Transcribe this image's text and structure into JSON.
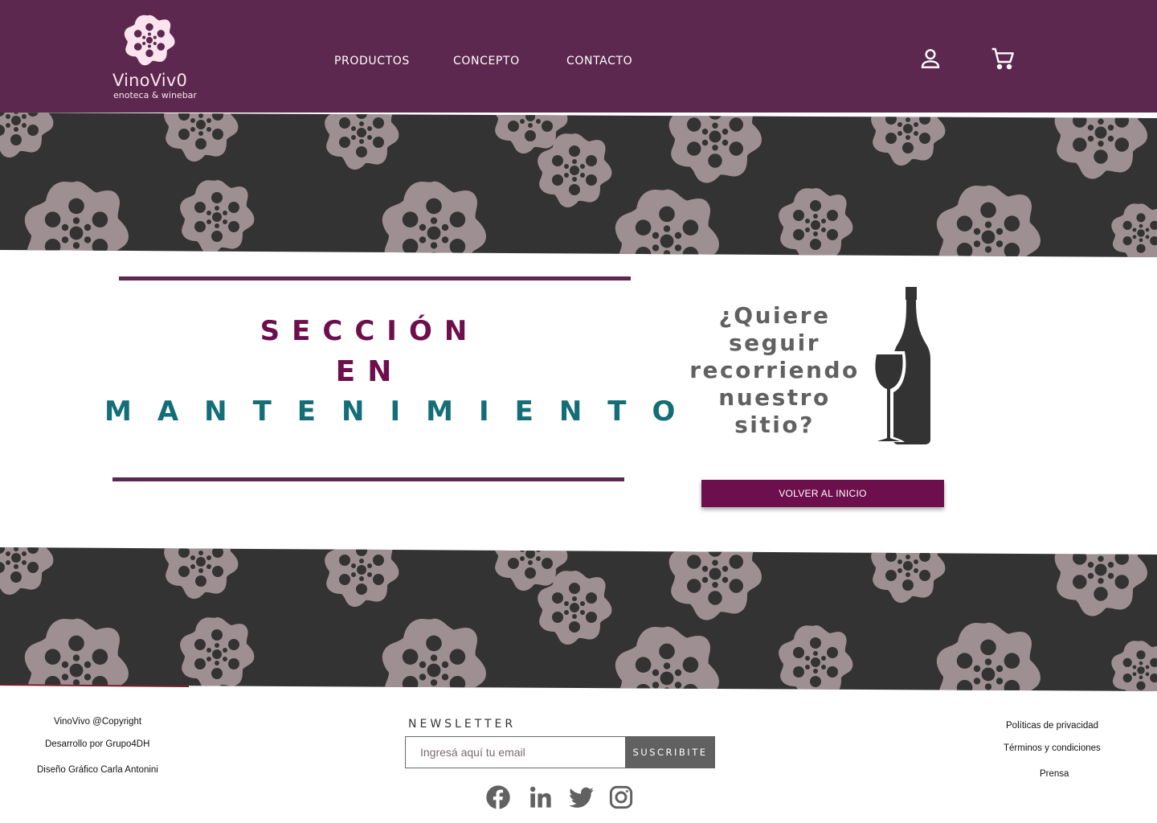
{
  "colors": {
    "header_bg": "#5c284f",
    "band_bg": "#333333",
    "pattern": "#9e9092",
    "title_purple": "#6d0f4d",
    "title_teal": "#136e78",
    "button_bg": "#6d0f4d",
    "newsletter_button_bg": "#616161"
  },
  "header": {
    "logo_icon": "wine-flower-logo",
    "logo_word": "VinoViv0",
    "logo_sub": "enoteca & winebar",
    "nav": [
      {
        "label": "PRODUCTOS"
      },
      {
        "label": "CONCEPTO"
      },
      {
        "label": "CONTACTO"
      }
    ],
    "user_icon": "user-icon",
    "cart_icon": "cart-icon"
  },
  "maintenance": {
    "line1": "SECCIÓN",
    "line2": "EN",
    "line3": "MANTENIMIENTO"
  },
  "aside": {
    "question": [
      "¿Quiere",
      "seguir",
      "recorriendo",
      "nuestro",
      "sitio?"
    ],
    "illustration": "wine-bottle-and-glass",
    "button_label": "VOLVER AL INICIO"
  },
  "footer": {
    "left": [
      "VinoVivo @Copyright",
      "Desarrollo por Grupo4DH",
      "Diseño Gráfico Carla Antonini"
    ],
    "newsletter": {
      "title": "NEWSLETTER",
      "placeholder": "Ingresá aquí tu email",
      "button_label": "SUSCRIBITE"
    },
    "social": [
      "facebook-icon",
      "linkedin-icon",
      "twitter-icon",
      "instagram-icon"
    ],
    "right": [
      "Políticas de privacidad",
      "Términos y condiciones",
      "Prensa"
    ]
  }
}
